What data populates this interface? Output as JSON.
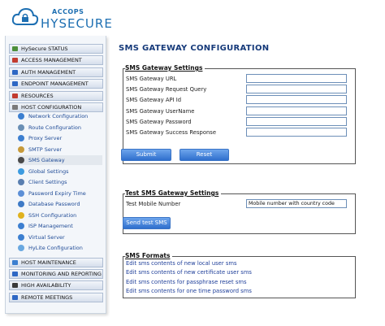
{
  "brand": {
    "top": "ACCOPS",
    "main": "HYSECURE"
  },
  "sidebar": {
    "top_items": [
      {
        "label": "HySecure STATUS",
        "color": "#4d8f3a"
      },
      {
        "label": "ACCESS MANAGEMENT",
        "color": "#c23b2e"
      },
      {
        "label": "AUTH MANAGEMENT",
        "color": "#2d67c4"
      },
      {
        "label": "ENDPOINT MANAGEMENT",
        "color": "#2d67c4"
      },
      {
        "label": "RESOURCES",
        "color": "#c23b2e"
      },
      {
        "label": "HOST CONFIGURATION",
        "color": "#7a7a7a"
      }
    ],
    "sub_items": [
      {
        "label": "Network Configuration",
        "icon": "network-icon",
        "color": "#3c7fd0"
      },
      {
        "label": "Route Configuration",
        "icon": "route-icon",
        "color": "#6a8fb5"
      },
      {
        "label": "Proxy Server",
        "icon": "proxy-icon",
        "color": "#3c7fd0"
      },
      {
        "label": "SMTP Server",
        "icon": "mail-icon",
        "color": "#c79a3a"
      },
      {
        "label": "SMS Gateway",
        "icon": "phone-icon",
        "color": "#4a4a4a"
      },
      {
        "label": "Global Settings",
        "icon": "globe-icon",
        "color": "#3c9be0"
      },
      {
        "label": "Client Settings",
        "icon": "client-icon",
        "color": "#5a7fb0"
      },
      {
        "label": "Password Expiry Time",
        "icon": "key-icon",
        "color": "#5c8fd6"
      },
      {
        "label": "Database Password",
        "icon": "database-icon",
        "color": "#3e7ac6"
      },
      {
        "label": "SSH Configuration",
        "icon": "bulb-icon",
        "color": "#e0b21f"
      },
      {
        "label": "ISP Management",
        "icon": "isp-icon",
        "color": "#3c7fd0"
      },
      {
        "label": "Virtual Server",
        "icon": "server-icon",
        "color": "#3c7fd0"
      },
      {
        "label": "HyLite Configuration",
        "icon": "hylite-icon",
        "color": "#6aa8e0"
      }
    ],
    "bottom_items": [
      {
        "label": "HOST MAINTENANCE",
        "color": "#3c7fd0"
      },
      {
        "label": "MONITORING AND REPORTING",
        "color": "#2d67c4"
      },
      {
        "label": "HIGH AVAILABILITY",
        "color": "#3a3a3a"
      },
      {
        "label": "REMOTE MEETINGS",
        "color": "#2d67c4"
      }
    ]
  },
  "main": {
    "title": "SMS GATEWAY CONFIGURATION",
    "settings": {
      "legend": "SMS Gateway Settings",
      "fields": [
        {
          "label": "SMS Gateway URL",
          "value": ""
        },
        {
          "label": "SMS Gateway Request Query",
          "value": ""
        },
        {
          "label": "SMS Gateway API Id",
          "value": ""
        },
        {
          "label": "SMS Gateway UserName",
          "value": ""
        },
        {
          "label": "SMS Gateway Password",
          "value": ""
        },
        {
          "label": "SMS Gateway Success Response",
          "value": ""
        }
      ],
      "submit_label": "Submit",
      "reset_label": "Reset"
    },
    "test": {
      "legend": "Test SMS Gateway Settings",
      "mobile_label": "Test Mobile Number",
      "mobile_value": "Mobile number with country code",
      "send_label": "Send test SMS"
    },
    "formats": {
      "legend": "SMS Formats",
      "links": [
        "Edit sms contents of new local user sms",
        "Edit sms contents of new certificate user sms",
        "Edit sms contents for passphrase reset sms",
        "Edit sms contents for one time password sms"
      ]
    }
  }
}
